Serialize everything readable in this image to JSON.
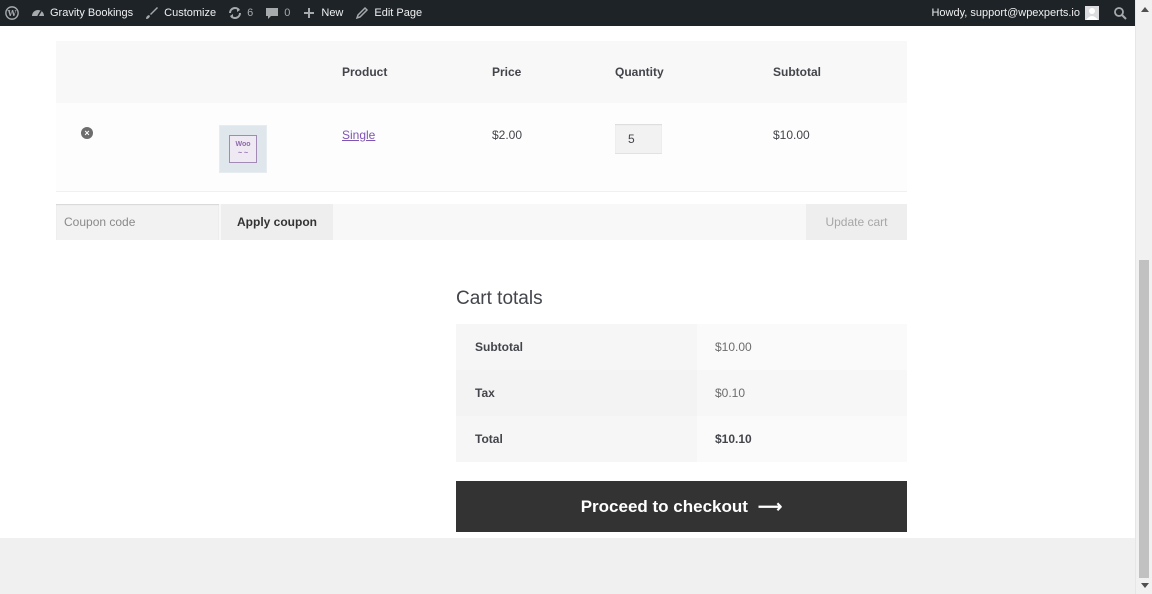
{
  "admin_bar": {
    "site_name": "Gravity Bookings",
    "customize": "Customize",
    "updates_count": "6",
    "comments_count": "0",
    "new": "New",
    "edit_page": "Edit Page",
    "howdy": "Howdy, support@wpexperts.io"
  },
  "cart": {
    "headers": {
      "product": "Product",
      "price": "Price",
      "quantity": "Quantity",
      "subtotal": "Subtotal"
    },
    "items": [
      {
        "remove_symbol": "×",
        "thumb_text": "Woo",
        "thumb_sub": "~ ~",
        "product": "Single",
        "price": "$2.00",
        "quantity": "5",
        "subtotal": "$10.00"
      }
    ],
    "coupon_placeholder": "Coupon code",
    "apply_coupon": "Apply coupon",
    "update_cart": "Update cart"
  },
  "totals": {
    "title": "Cart totals",
    "rows": [
      {
        "label": "Subtotal",
        "value": "$10.00"
      },
      {
        "label": "Tax",
        "value": "$0.10"
      },
      {
        "label": "Total",
        "value": "$10.10"
      }
    ],
    "checkout": "Proceed to checkout",
    "checkout_arrow": "⟶"
  }
}
